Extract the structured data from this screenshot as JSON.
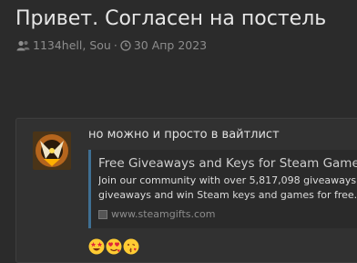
{
  "thread": {
    "title": "Привет. Согласен на постель",
    "participants": "1134hell, Sou",
    "date": "30 Апр 2023"
  },
  "post": {
    "message": "но можно и просто в вайтлист",
    "embed": {
      "title": "Free Giveaways and Keys for Steam Games",
      "description_line1": "Join our community with over 5,817,098 giveaways",
      "description_line2": "giveaways and win Steam keys and games for free.",
      "site": "www.steamgifts.com"
    },
    "reactions": [
      "star-struck-emoji",
      "heart-face-emoji",
      "kissing-emoji"
    ]
  },
  "colors": {
    "background": "#2b2b2b",
    "post_background": "#313131",
    "embed_accent": "#3f6f93"
  }
}
